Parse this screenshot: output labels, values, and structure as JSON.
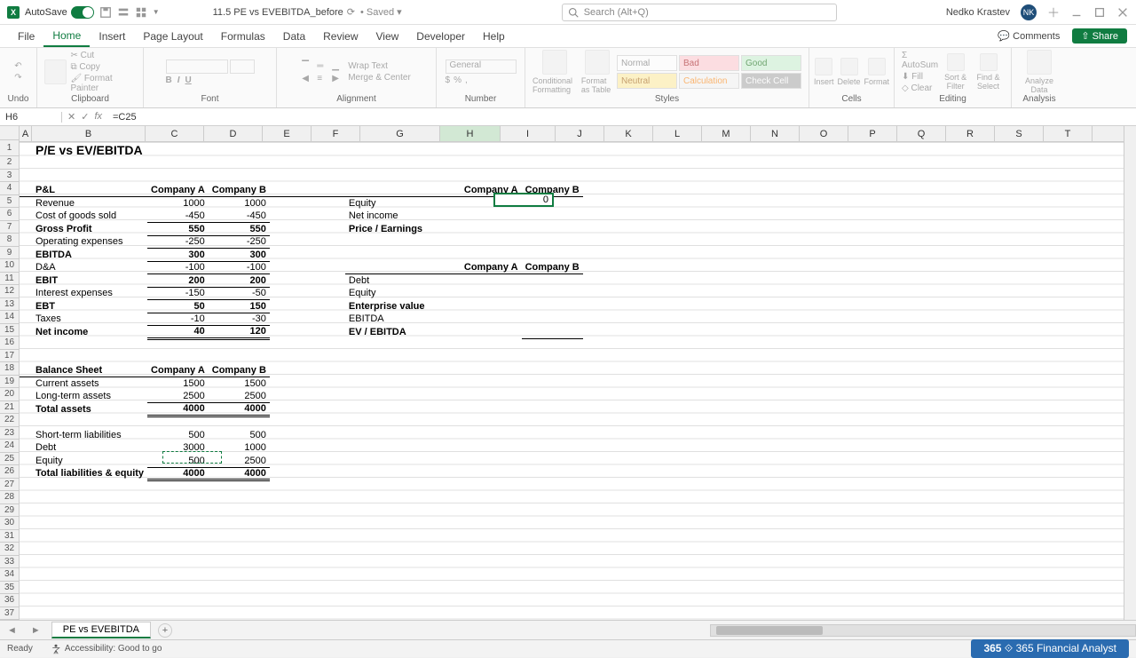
{
  "titlebar": {
    "autosave_label": "AutoSave",
    "filename": "11.5 PE vs EVEBITDA_before",
    "saved_state": "Saved",
    "search_placeholder": "Search (Alt+Q)",
    "username": "Nedko Krastev",
    "avatar_initials": "NK"
  },
  "ribbon_tabs": [
    "File",
    "Home",
    "Insert",
    "Page Layout",
    "Formulas",
    "Data",
    "Review",
    "View",
    "Developer",
    "Help"
  ],
  "ribbon_active_tab": "Home",
  "comments_label": "Comments",
  "share_label": "Share",
  "ribbon_groups": {
    "undo": "Undo",
    "clipboard": "Clipboard",
    "cut": "Cut",
    "copy": "Copy",
    "format_painter": "Format Painter",
    "font": "Font",
    "alignment": "Alignment",
    "wrap": "Wrap Text",
    "merge": "Merge & Center",
    "number": "Number",
    "number_fmt": "General",
    "cond_fmt": "Conditional Formatting",
    "fmt_table": "Format as Table",
    "styles": "Styles",
    "style_normal": "Normal",
    "style_bad": "Bad",
    "style_good": "Good",
    "style_neutral": "Neutral",
    "style_calc": "Calculation",
    "style_check": "Check Cell",
    "cells": "Cells",
    "insert": "Insert",
    "delete": "Delete",
    "format": "Format",
    "editing": "Editing",
    "autosum": "AutoSum",
    "fill": "Fill",
    "clear": "Clear",
    "sort": "Sort & Filter",
    "find": "Find & Select",
    "analysis": "Analysis",
    "analyze": "Analyze Data"
  },
  "formula": {
    "name_box": "H6",
    "formula": "=C25"
  },
  "columns": [
    "A",
    "B",
    "C",
    "D",
    "E",
    "F",
    "G",
    "H",
    "I",
    "J",
    "K",
    "L",
    "M",
    "N",
    "O",
    "P",
    "Q",
    "R",
    "S",
    "T"
  ],
  "title": "P/E vs EV/EBITDA",
  "pl": {
    "header": "P&L",
    "company_a": "Company A",
    "company_b": "Company B",
    "rows": [
      {
        "label": "Revenue",
        "a": "1000",
        "b": "1000"
      },
      {
        "label": "Cost of goods sold",
        "a": "-450",
        "b": "-450"
      },
      {
        "label": "Gross Profit",
        "a": "550",
        "b": "550",
        "bold": true,
        "line": true
      },
      {
        "label": "Operating expenses",
        "a": "-250",
        "b": "-250"
      },
      {
        "label": "EBITDA",
        "a": "300",
        "b": "300",
        "bold": true,
        "line": true
      },
      {
        "label": "D&A",
        "a": "-100",
        "b": "-100"
      },
      {
        "label": "EBIT",
        "a": "200",
        "b": "200",
        "bold": true,
        "line": true
      },
      {
        "label": "Interest expenses",
        "a": "-150",
        "b": "-50"
      },
      {
        "label": "EBT",
        "a": "50",
        "b": "150",
        "bold": true,
        "line": true
      },
      {
        "label": "Taxes",
        "a": "-10",
        "b": "-30"
      },
      {
        "label": "Net income",
        "a": "40",
        "b": "120",
        "bold": true,
        "dbl": true
      }
    ]
  },
  "bs": {
    "header": "Balance Sheet",
    "company_a": "Company A",
    "company_b": "Company B",
    "rows": [
      {
        "label": "Current assets",
        "a": "1500",
        "b": "1500"
      },
      {
        "label": "Long-term assets",
        "a": "2500",
        "b": "2500"
      },
      {
        "label": "Total assets",
        "a": "4000",
        "b": "4000",
        "bold": true,
        "dbl": true
      },
      {
        "label": "",
        "a": "",
        "b": ""
      },
      {
        "label": "Short-term liabilities",
        "a": "500",
        "b": "500"
      },
      {
        "label": "Debt",
        "a": "3000",
        "b": "1000"
      },
      {
        "label": "Equity",
        "a": "500",
        "b": "2500"
      },
      {
        "label": "Total liabilities & equity",
        "a": "4000",
        "b": "4000",
        "bold": true,
        "dbl": true
      }
    ]
  },
  "right1": {
    "company_a": "Company A",
    "company_b": "Company B",
    "rows": [
      {
        "label": "Equity"
      },
      {
        "label": "Net income"
      },
      {
        "label": "Price / Earnings",
        "bold": true
      }
    ]
  },
  "right2": {
    "company_a": "Company A",
    "company_b": "Company B",
    "rows": [
      {
        "label": "Debt"
      },
      {
        "label": "Equity"
      },
      {
        "label": "Enterprise value",
        "bold": true
      },
      {
        "label": "EBITDA"
      },
      {
        "label": "EV / EBITDA",
        "bold": true
      }
    ]
  },
  "edit_value": "0",
  "sheet_tab": "PE vs EVEBITDA",
  "status": {
    "ready": "Ready",
    "accessibility": "Accessibility: Good to go"
  },
  "brand": "365 Financial Analyst"
}
